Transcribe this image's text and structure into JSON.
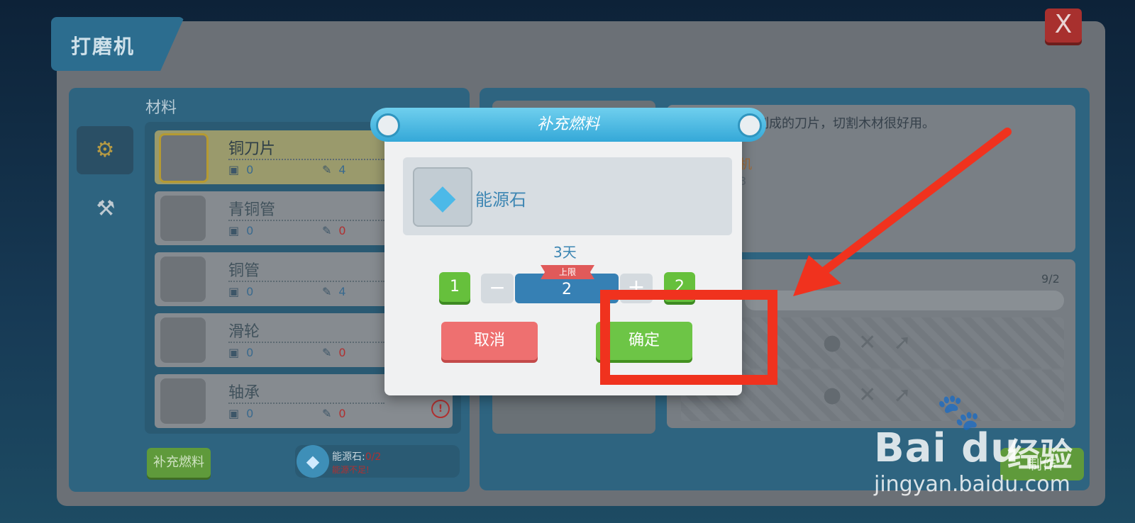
{
  "window": {
    "title": "打磨机",
    "close_label": "X"
  },
  "left_panel": {
    "section_label": "材料",
    "materials": [
      {
        "name": "铜刀片",
        "stat_a": "0",
        "stat_b": "4"
      },
      {
        "name": "青铜管",
        "stat_a": "0",
        "stat_b": "0"
      },
      {
        "name": "铜管",
        "stat_a": "0",
        "stat_b": "4"
      },
      {
        "name": "滑轮",
        "stat_a": "0",
        "stat_b": "0"
      },
      {
        "name": "轴承",
        "stat_a": "0",
        "stat_b": "0"
      }
    ],
    "refuel_button": "补充燃料",
    "energy": {
      "label": "能源石:",
      "value": "0/2",
      "warning": "能源不足!"
    }
  },
  "right_panel": {
    "description": "制成的刀片，切割木材很好用。",
    "source_suffix": "机",
    "source_value": "3",
    "requirement_count": "9/2",
    "make_button": "制作"
  },
  "dialog": {
    "title": "补充燃料",
    "item_name": "能源石",
    "duration": "3天",
    "min_quick": "1",
    "max_quick": "2",
    "limit_label": "上限",
    "quantity": "2",
    "cancel": "取消",
    "confirm": "确定"
  },
  "watermark": {
    "brand": "Bai du",
    "suffix": "经验",
    "url": "jingyan.baidu.com"
  },
  "colors": {
    "annotation": "#f0321e",
    "confirm_green": "#6dc546",
    "cancel_red": "#ee7070",
    "header_blue": "#34a8d8"
  },
  "icons": [
    "close-icon",
    "machine-tab-icon",
    "workbench-tab-icon",
    "robot-icon",
    "wrench-icon",
    "warning-icon",
    "energy-stone-icon",
    "minus-icon",
    "plus-icon",
    "arrow-annotation"
  ]
}
